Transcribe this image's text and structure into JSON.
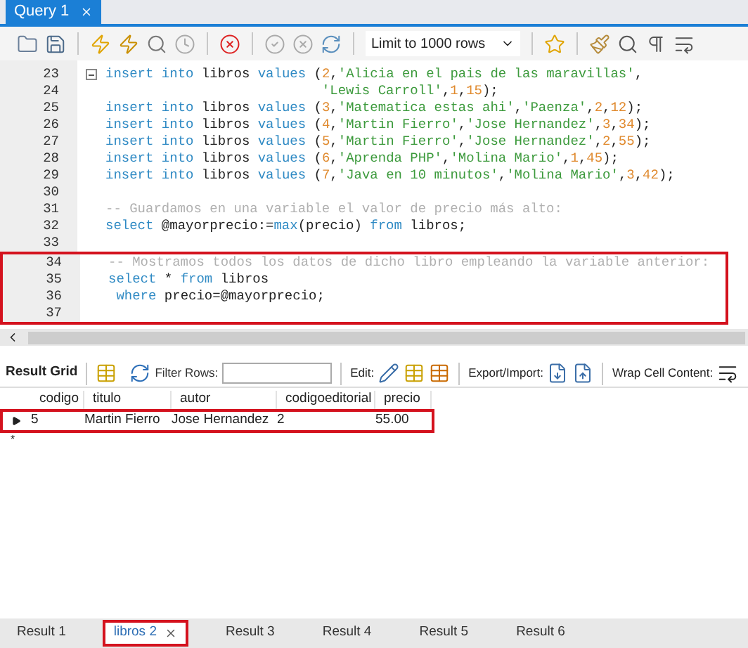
{
  "editor_tabs": [
    {
      "label": "Query 1",
      "selected": true
    }
  ],
  "toolbar": {
    "limit_select": "Limit to 1000 rows"
  },
  "code_lines": [
    {
      "number": "23",
      "fold": true,
      "tokens": [
        {
          "kind": "keyword",
          "text": "insert"
        },
        {
          "kind": "keyword",
          "text": " into"
        },
        {
          "kind": "plain",
          "text": " libros "
        },
        {
          "kind": "keyword",
          "text": "values"
        },
        {
          "kind": "plain",
          "text": " ("
        },
        {
          "kind": "number",
          "text": "2"
        },
        {
          "kind": "plain",
          "text": ","
        },
        {
          "kind": "string",
          "text": "'Alicia en el pais de las maravillas'"
        },
        {
          "kind": "plain",
          "text": ","
        }
      ]
    },
    {
      "number": "24",
      "tokens": [
        {
          "kind": "string",
          "text": "                           'Lewis Carroll'"
        },
        {
          "kind": "plain",
          "text": ","
        },
        {
          "kind": "number",
          "text": "1"
        },
        {
          "kind": "plain",
          "text": ","
        },
        {
          "kind": "number",
          "text": "15"
        },
        {
          "kind": "plain",
          "text": ");"
        }
      ]
    },
    {
      "number": "25",
      "tokens": [
        {
          "kind": "keyword",
          "text": "insert"
        },
        {
          "kind": "keyword",
          "text": " into"
        },
        {
          "kind": "plain",
          "text": " libros "
        },
        {
          "kind": "keyword",
          "text": "values"
        },
        {
          "kind": "plain",
          "text": " ("
        },
        {
          "kind": "number",
          "text": "3"
        },
        {
          "kind": "plain",
          "text": ","
        },
        {
          "kind": "string",
          "text": "'Matematica estas ahi'"
        },
        {
          "kind": "plain",
          "text": ","
        },
        {
          "kind": "string",
          "text": "'Paenza'"
        },
        {
          "kind": "plain",
          "text": ","
        },
        {
          "kind": "number",
          "text": "2"
        },
        {
          "kind": "plain",
          "text": ","
        },
        {
          "kind": "number",
          "text": "12"
        },
        {
          "kind": "plain",
          "text": ");"
        }
      ]
    },
    {
      "number": "26",
      "tokens": [
        {
          "kind": "keyword",
          "text": "insert"
        },
        {
          "kind": "keyword",
          "text": " into"
        },
        {
          "kind": "plain",
          "text": " libros "
        },
        {
          "kind": "keyword",
          "text": "values"
        },
        {
          "kind": "plain",
          "text": " ("
        },
        {
          "kind": "number",
          "text": "4"
        },
        {
          "kind": "plain",
          "text": ","
        },
        {
          "kind": "string",
          "text": "'Martin Fierro'"
        },
        {
          "kind": "plain",
          "text": ","
        },
        {
          "kind": "string",
          "text": "'Jose Hernandez'"
        },
        {
          "kind": "plain",
          "text": ","
        },
        {
          "kind": "number",
          "text": "3"
        },
        {
          "kind": "plain",
          "text": ","
        },
        {
          "kind": "number",
          "text": "34"
        },
        {
          "kind": "plain",
          "text": ");"
        }
      ]
    },
    {
      "number": "27",
      "tokens": [
        {
          "kind": "keyword",
          "text": "insert"
        },
        {
          "kind": "keyword",
          "text": " into"
        },
        {
          "kind": "plain",
          "text": " libros "
        },
        {
          "kind": "keyword",
          "text": "values"
        },
        {
          "kind": "plain",
          "text": " ("
        },
        {
          "kind": "number",
          "text": "5"
        },
        {
          "kind": "plain",
          "text": ","
        },
        {
          "kind": "string",
          "text": "'Martin Fierro'"
        },
        {
          "kind": "plain",
          "text": ","
        },
        {
          "kind": "string",
          "text": "'Jose Hernandez'"
        },
        {
          "kind": "plain",
          "text": ","
        },
        {
          "kind": "number",
          "text": "2"
        },
        {
          "kind": "plain",
          "text": ","
        },
        {
          "kind": "number",
          "text": "55"
        },
        {
          "kind": "plain",
          "text": ");"
        }
      ]
    },
    {
      "number": "28",
      "tokens": [
        {
          "kind": "keyword",
          "text": "insert"
        },
        {
          "kind": "keyword",
          "text": " into"
        },
        {
          "kind": "plain",
          "text": " libros "
        },
        {
          "kind": "keyword",
          "text": "values"
        },
        {
          "kind": "plain",
          "text": " ("
        },
        {
          "kind": "number",
          "text": "6"
        },
        {
          "kind": "plain",
          "text": ","
        },
        {
          "kind": "string",
          "text": "'Aprenda PHP'"
        },
        {
          "kind": "plain",
          "text": ","
        },
        {
          "kind": "string",
          "text": "'Molina Mario'"
        },
        {
          "kind": "plain",
          "text": ","
        },
        {
          "kind": "number",
          "text": "1"
        },
        {
          "kind": "plain",
          "text": ","
        },
        {
          "kind": "number",
          "text": "45"
        },
        {
          "kind": "plain",
          "text": ");"
        }
      ]
    },
    {
      "number": "29",
      "tokens": [
        {
          "kind": "keyword",
          "text": "insert"
        },
        {
          "kind": "keyword",
          "text": " into"
        },
        {
          "kind": "plain",
          "text": " libros "
        },
        {
          "kind": "keyword",
          "text": "values"
        },
        {
          "kind": "plain",
          "text": " ("
        },
        {
          "kind": "number",
          "text": "7"
        },
        {
          "kind": "plain",
          "text": ","
        },
        {
          "kind": "string",
          "text": "'Java en 10 minutos'"
        },
        {
          "kind": "plain",
          "text": ","
        },
        {
          "kind": "string",
          "text": "'Molina Mario'"
        },
        {
          "kind": "plain",
          "text": ","
        },
        {
          "kind": "number",
          "text": "3"
        },
        {
          "kind": "plain",
          "text": ","
        },
        {
          "kind": "number",
          "text": "42"
        },
        {
          "kind": "plain",
          "text": ");"
        }
      ]
    },
    {
      "number": "30"
    },
    {
      "number": "31",
      "tokens": [
        {
          "kind": "comment",
          "text": "-- Guardamos en una variable el valor de precio más alto:"
        }
      ]
    },
    {
      "number": "32",
      "tokens": [
        {
          "kind": "keyword",
          "text": "select"
        },
        {
          "kind": "plain",
          "text": " @mayorprecio:="
        },
        {
          "kind": "keyword",
          "text": "max"
        },
        {
          "kind": "plain",
          "text": "(precio) "
        },
        {
          "kind": "keyword",
          "text": "from"
        },
        {
          "kind": "plain",
          "text": " libros;"
        }
      ]
    },
    {
      "number": "33"
    },
    {
      "number": "34",
      "boxed": true,
      "tokens": [
        {
          "kind": "comment",
          "text": "-- Mostramos todos los datos de dicho libro empleando la variable anterior:"
        }
      ]
    },
    {
      "number": "35",
      "boxed": true,
      "tokens": [
        {
          "kind": "keyword",
          "text": "select"
        },
        {
          "kind": "plain",
          "text": " * "
        },
        {
          "kind": "keyword",
          "text": "from"
        },
        {
          "kind": "plain",
          "text": " libros"
        }
      ]
    },
    {
      "number": "36",
      "boxed": true,
      "tokens": [
        {
          "kind": "keyword",
          "text": " where"
        },
        {
          "kind": "plain",
          "text": " precio=@mayorprecio;"
        }
      ]
    },
    {
      "number": "37",
      "boxed": true
    }
  ],
  "result_toolbar": {
    "result_grid": "Result Grid",
    "filter_label": "Filter Rows:",
    "edit_label": "Edit:",
    "export_label": "Export/Import:",
    "wrap_label": "Wrap Cell Content:"
  },
  "grid": {
    "columns": [
      "codigo",
      "titulo",
      "autor",
      "codigoeditorial",
      "precio"
    ],
    "rows": [
      {
        "cells": [
          "5",
          "Martin Fierro",
          "Jose Hernandez",
          "2",
          "55.00"
        ],
        "selected": true,
        "boxed": true
      }
    ],
    "new_row_marker": "*"
  },
  "result_tabs": [
    {
      "label": "Result 1",
      "selected": false,
      "boxed": false
    },
    {
      "label": "libros 2",
      "selected": true,
      "boxed": true
    },
    {
      "label": "Result 3",
      "selected": false,
      "boxed": false
    },
    {
      "label": "Result 4",
      "selected": false,
      "boxed": false
    },
    {
      "label": "Result 5",
      "selected": false,
      "boxed": false
    },
    {
      "label": "Result 6",
      "selected": false,
      "boxed": false
    }
  ]
}
